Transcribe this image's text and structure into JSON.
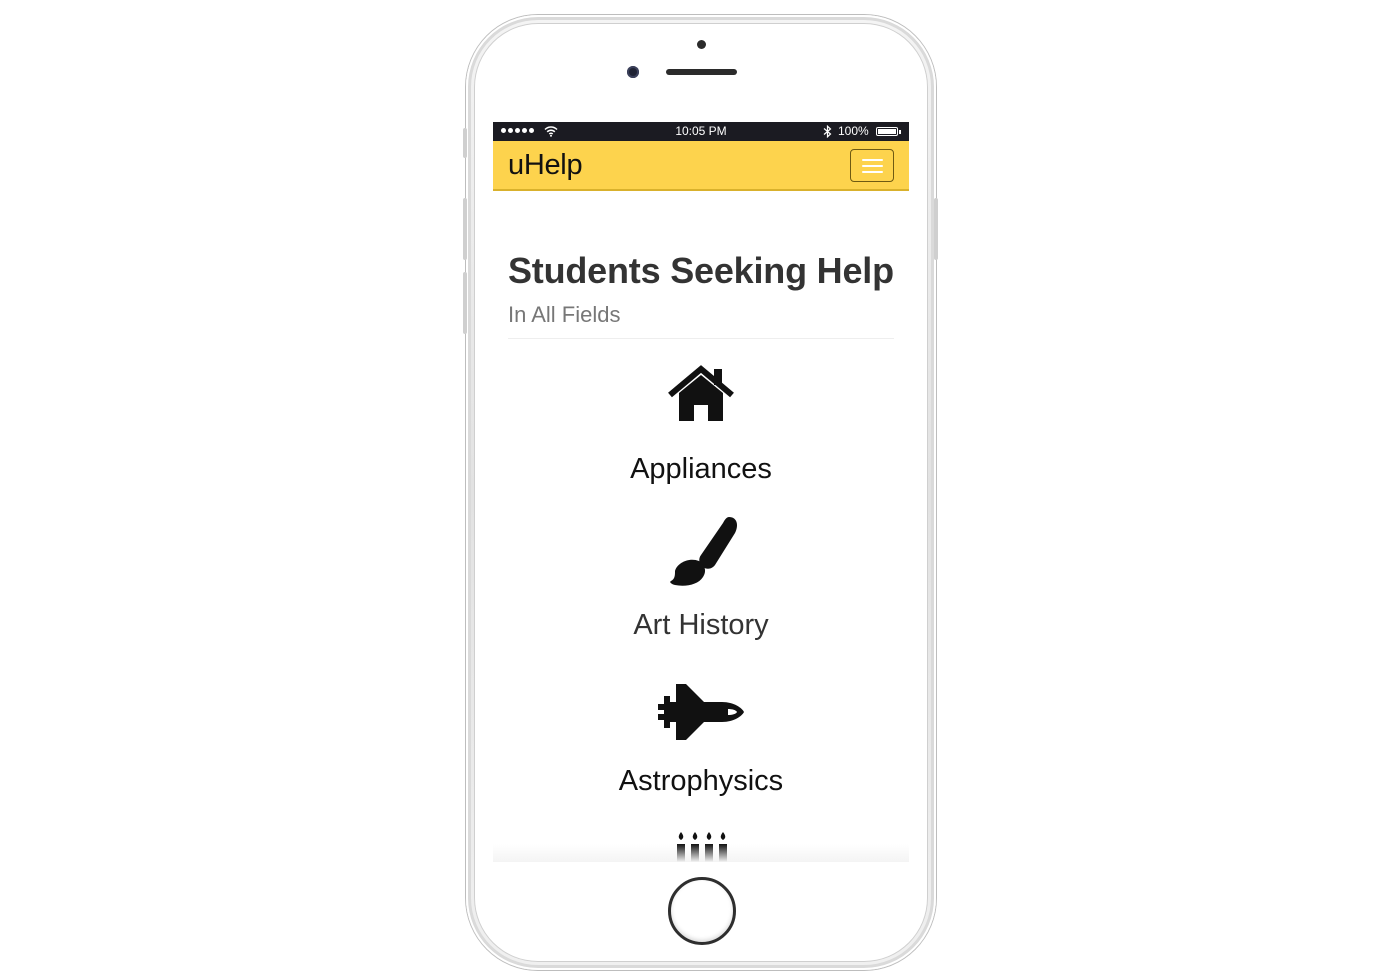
{
  "status_bar": {
    "time": "10:05 PM",
    "battery": "100%",
    "signal_icon": "signal-dots-icon",
    "wifi_icon": "wifi-icon",
    "bluetooth_icon": "bluetooth-icon",
    "battery_icon": "battery-icon"
  },
  "navbar": {
    "brand": "uHelp",
    "toggle_icon": "hamburger-menu-icon",
    "background_color": "#fdd34d"
  },
  "page": {
    "title": "Students Seeking Help",
    "subtitle": "In All Fields"
  },
  "categories": [
    {
      "label": "Appliances",
      "icon": "house-icon"
    },
    {
      "label": "Art History",
      "icon": "paintbrush-icon"
    },
    {
      "label": "Astrophysics",
      "icon": "space-shuttle-icon"
    },
    {
      "label": "",
      "icon": "birthday-candles-icon"
    }
  ]
}
